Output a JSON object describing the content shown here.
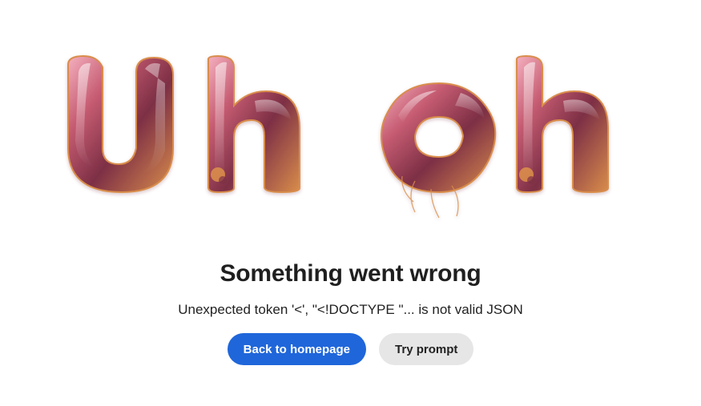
{
  "hero": {
    "art_text": "Uh oh",
    "icon": "balloon-letters-illustration"
  },
  "error": {
    "title": "Something went wrong",
    "message": "Unexpected token '<', \"<!DOCTYPE \"... is not valid JSON"
  },
  "actions": {
    "back_label": "Back to homepage",
    "try_label": "Try prompt"
  },
  "colors": {
    "primary": "#1f66da",
    "secondary_bg": "#e6e6e6",
    "balloon_base": "#c65c72",
    "balloon_light": "#f4b0bf",
    "balloon_dark": "#7d2f45",
    "balloon_edge": "#d98d4b"
  }
}
